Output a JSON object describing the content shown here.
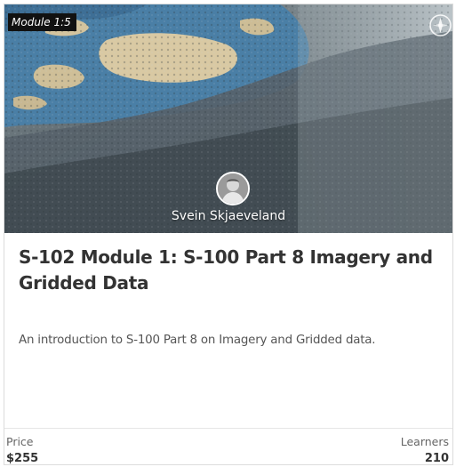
{
  "card": {
    "badge": "Module 1:5",
    "instructor": "Svein Skjaeveland",
    "title": "S-102 Module 1: S-100 Part 8 Imagery and Gridded Data",
    "description": "An introduction to S-100 Part 8 on Imagery and Gridded data.",
    "price_label": "Price",
    "price_value": "$255",
    "learners_label": "Learners",
    "learners_value": "210"
  },
  "icons": {
    "compass": "compass-icon",
    "avatar": "instructor-avatar"
  },
  "colors": {
    "water": "#4a7fa6",
    "land": "#d9c9a3",
    "terrain": "#6b7880",
    "badge_bg": "#111111",
    "text_primary": "#333333"
  }
}
